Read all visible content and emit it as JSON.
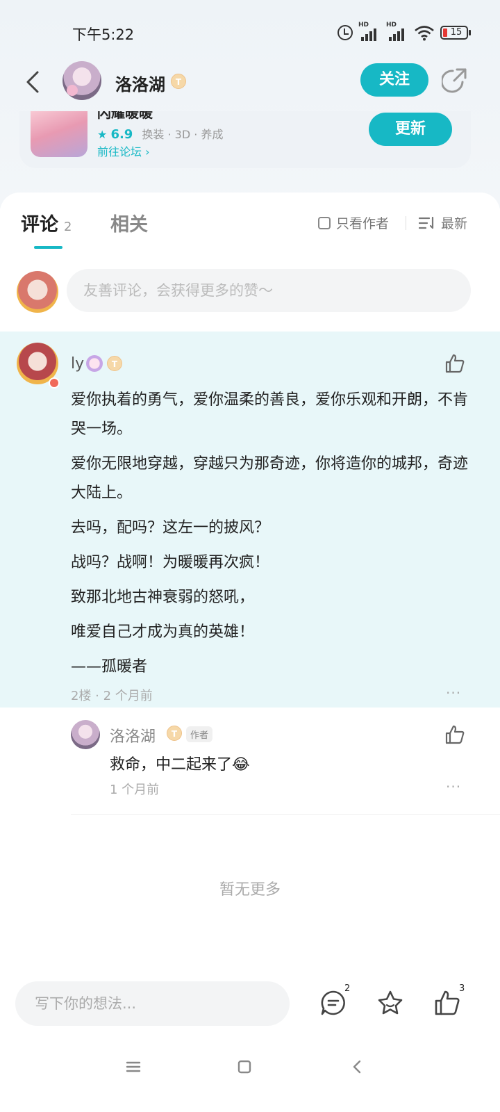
{
  "status_bar": {
    "time": "下午5:22",
    "hd1": "HD",
    "hd2": "HD",
    "battery": "15"
  },
  "header": {
    "user_name": "洛洛湖",
    "badge": "T",
    "follow_label": "关注"
  },
  "game": {
    "title": "闪耀暖暖",
    "score": "6.9",
    "tags": "换装 · 3D · 养成",
    "forum_link": "前往论坛",
    "update_label": "更新"
  },
  "tabs": {
    "comment_label": "评论",
    "comment_count": "2",
    "related_label": "相关",
    "author_only_label": "只看作者",
    "sort_label": "最新"
  },
  "comment_input": {
    "placeholder": "友善评论，会获得更多的赞～"
  },
  "comment": {
    "user": "ly",
    "badge": "T",
    "paragraphs": [
      "爱你执着的勇气，爱你温柔的善良，爱你乐观和开朗，不肯哭一场。",
      "爱你无限地穿越，穿越只为那奇迹，你将造你的城邦，奇迹大陆上。",
      "去吗，配吗？这左一的披风？",
      "战吗？战啊！为暖暖再次疯！",
      "致那北地古神衰弱的怒吼，",
      "唯爱自己才成为真的英雄！",
      "——孤暖者"
    ],
    "meta": "2楼 · 2 个月前",
    "more": "···"
  },
  "reply": {
    "user": "洛洛湖",
    "badge": "T",
    "author_tag": "作者",
    "text": "救命，中二起来了😂",
    "meta": "1 个月前",
    "more": "···"
  },
  "footer": {
    "no_more": "暂无更多"
  },
  "bottom_bar": {
    "placeholder": "写下你的想法...",
    "comment_count": "2",
    "like_count": "3"
  },
  "colors": {
    "accent": "#17b8c5",
    "comment_bg": "#e8f7f9"
  }
}
